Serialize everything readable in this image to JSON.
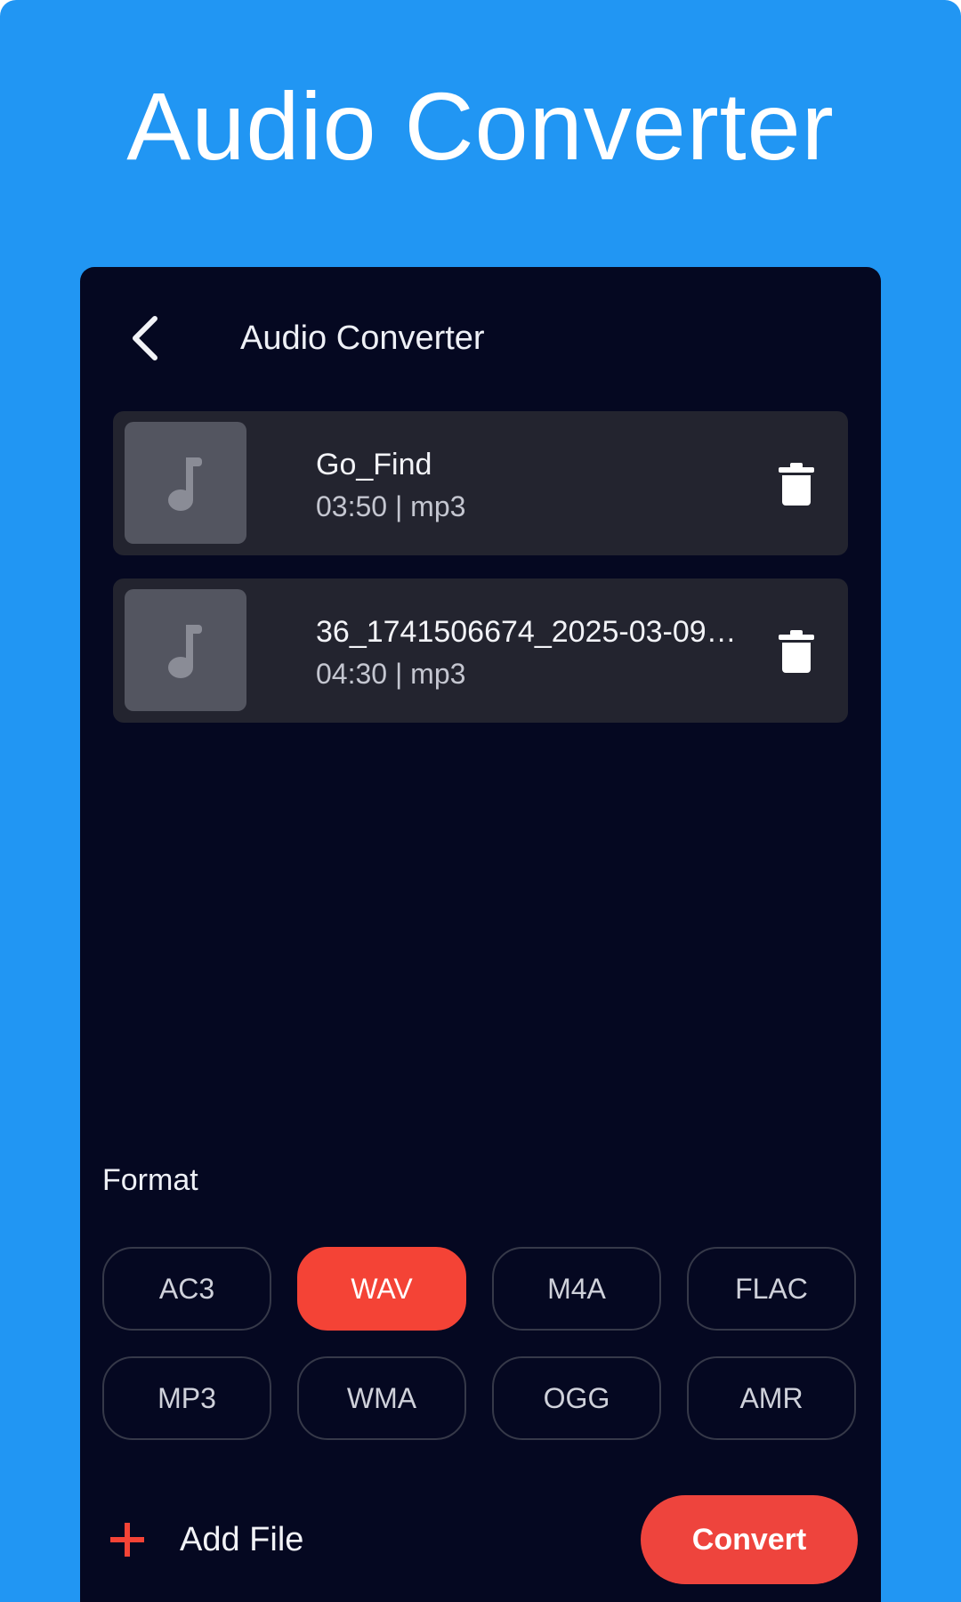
{
  "promo": {
    "title": "Audio Converter"
  },
  "appbar": {
    "title": "Audio Converter"
  },
  "files": [
    {
      "name": "Go_Find",
      "meta": "03:50 | mp3"
    },
    {
      "name": "36_1741506674_2025-03-09…",
      "meta": "04:30 | mp3"
    }
  ],
  "format": {
    "label": "Format",
    "options": [
      "AC3",
      "WAV",
      "M4A",
      "FLAC",
      "MP3",
      "WMA",
      "OGG",
      "AMR"
    ],
    "selected": "WAV"
  },
  "actions": {
    "add_file_label": "Add File",
    "convert_label": "Convert"
  },
  "colors": {
    "background": "#2196F3",
    "panel": "#050821",
    "accent": "#F44336"
  }
}
